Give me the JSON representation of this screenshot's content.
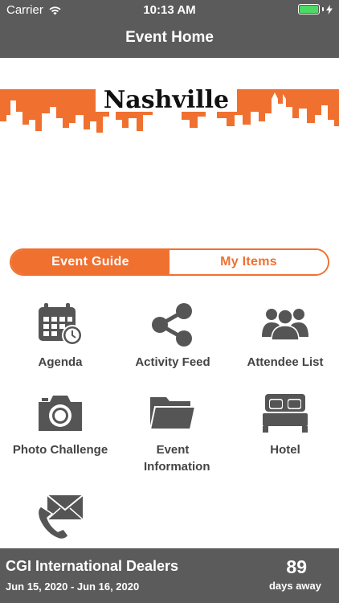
{
  "status_bar": {
    "carrier": "Carrier",
    "time": "10:13 AM"
  },
  "nav": {
    "title": "Event Home"
  },
  "banner": {
    "city": "Nashville",
    "accent_color": "#f07030"
  },
  "segment": {
    "active_label": "Event Guide",
    "inactive_label": "My Items"
  },
  "grid": {
    "items": [
      {
        "label": "Agenda",
        "icon": "calendar-clock-icon"
      },
      {
        "label": "Activity Feed",
        "icon": "share-icon"
      },
      {
        "label": "Attendee List",
        "icon": "people-icon"
      },
      {
        "label": "Photo Challenge",
        "icon": "camera-icon"
      },
      {
        "label": "Event Information",
        "icon": "folder-icon"
      },
      {
        "label": "Hotel",
        "icon": "bed-icon"
      },
      {
        "label": "",
        "icon": "phone-mail-icon"
      }
    ]
  },
  "footer": {
    "event_name": "CGI International Dealers",
    "dates": "Jun 15, 2020 - Jun 16, 2020",
    "days_count": "89",
    "days_label": "days away"
  }
}
